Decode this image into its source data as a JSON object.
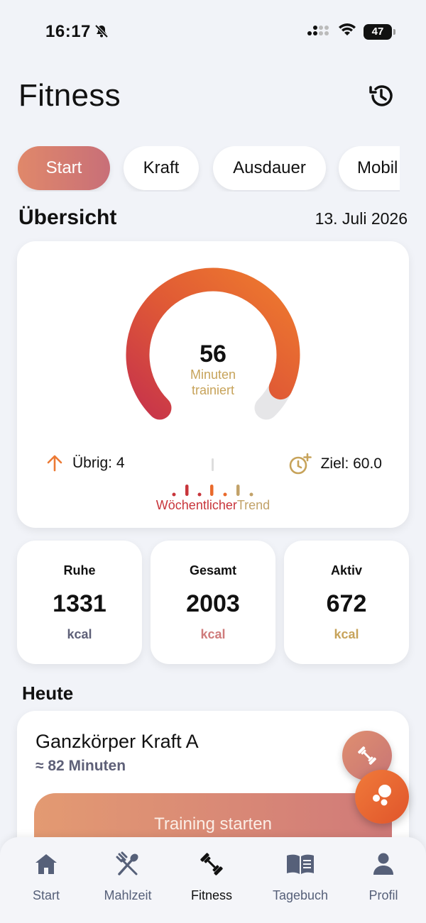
{
  "status_bar": {
    "time": "16:17",
    "battery": "47"
  },
  "header": {
    "title": "Fitness"
  },
  "tabs": [
    {
      "label": "Start",
      "active": true
    },
    {
      "label": "Kraft",
      "active": false
    },
    {
      "label": "Ausdauer",
      "active": false
    },
    {
      "label": "Mobil",
      "active": false
    }
  ],
  "overview": {
    "title": "Übersicht",
    "date": "13. Juli 2026",
    "gauge": {
      "value": "56",
      "label_line1": "Minuten",
      "label_line2": "trainiert",
      "progress": 0.93
    },
    "remaining": "Übrig: 4",
    "goal": "Ziel: 60.0",
    "trend_label_part1": "Wöchentlicher",
    "trend_label_part2": "Trend"
  },
  "kcal_cards": [
    {
      "title": "Ruhe",
      "value": "1331",
      "unit": "kcal",
      "unit_color": "#5e6078"
    },
    {
      "title": "Gesamt",
      "value": "2003",
      "unit": "kcal",
      "unit_color": "#cf7b7b"
    },
    {
      "title": "Aktiv",
      "value": "672",
      "unit": "kcal",
      "unit_color": "#c7a35a"
    }
  ],
  "today": {
    "title": "Heute",
    "workout_name": "Ganzkörper Kraft A",
    "workout_duration": "≈ 82 Minuten",
    "start_button": "Training starten"
  },
  "nav": [
    {
      "label": "Start",
      "icon": "home-icon",
      "active": false
    },
    {
      "label": "Mahlzeit",
      "icon": "utensils-icon",
      "active": false
    },
    {
      "label": "Fitness",
      "icon": "dumbbell-icon",
      "active": true
    },
    {
      "label": "Tagebuch",
      "icon": "book-icon",
      "active": false
    },
    {
      "label": "Profil",
      "icon": "user-icon",
      "active": false
    }
  ],
  "colors": {
    "accent_orange": "#e86a2e",
    "accent_red": "#c8353b",
    "accent_gold": "#c7a35a"
  }
}
